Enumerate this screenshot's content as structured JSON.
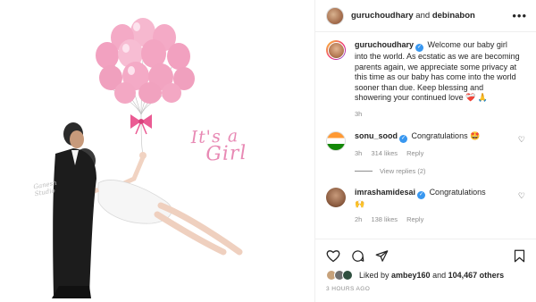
{
  "post_image": {
    "headline_line1": "It's a",
    "headline_line2": "Girl",
    "watermark_line1": "Ganesh",
    "watermark_line2": "Studio",
    "balloon_color": "#f2a7c3",
    "bow_color": "#ea5b93"
  },
  "header": {
    "username": "guruchoudhary",
    "joiner": " and ",
    "collaborator": "debinabon",
    "more_icon": "more-horizontal-icon"
  },
  "caption": {
    "username": "guruchoudhary",
    "verified_badge": "✓",
    "text": "Welcome our baby girl into the world. As ecstatic as we are becoming parents again, we appreciate some privacy at this time as our baby has come into the world sooner than due. Keep blessing and showering your continued love",
    "emojis": "❤️‍🩹 🙏",
    "time": "3h"
  },
  "comments": [
    {
      "username": "sonu_sood",
      "verified_badge": "✓",
      "text": "Congratulations",
      "emoji": "🤩",
      "time": "3h",
      "likes": "314 likes",
      "reply": "Reply",
      "view_replies": "View replies (2)"
    },
    {
      "username": "imrashamidesai",
      "verified_badge": "✓",
      "text": "Congratulations",
      "emoji": "🙌",
      "time": "2h",
      "likes": "138 likes",
      "reply": "Reply"
    }
  ],
  "actions": {
    "liked_by_prefix": "Liked by ",
    "liked_by_user": "ambey160",
    "liked_by_joiner": " and ",
    "liked_by_count": "104,467 others",
    "timestamp": "3 HOURS AGO"
  }
}
